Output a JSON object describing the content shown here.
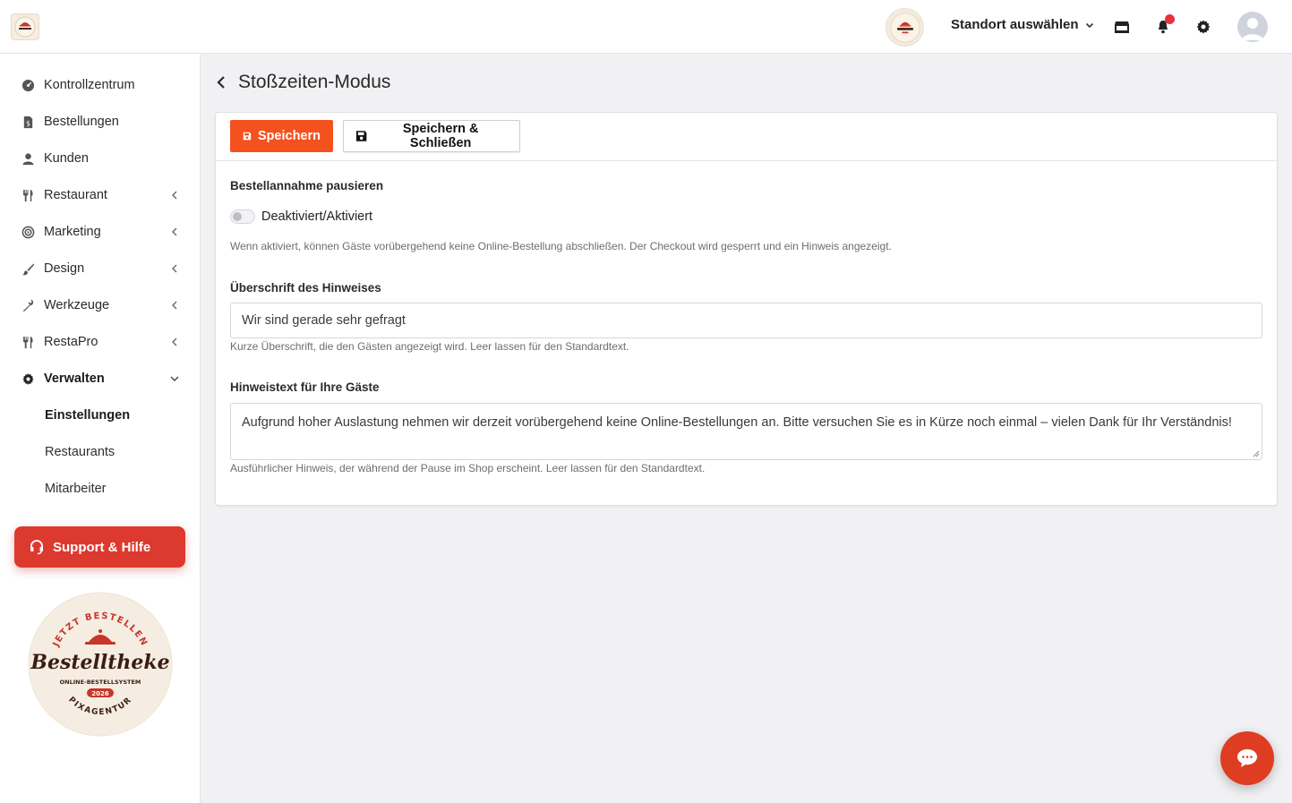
{
  "header": {
    "location_label": "Standort auswählen"
  },
  "sidebar": {
    "items": [
      {
        "label": "Kontrollzentrum"
      },
      {
        "label": "Bestellungen"
      },
      {
        "label": "Kunden"
      },
      {
        "label": "Restaurant"
      },
      {
        "label": "Marketing"
      },
      {
        "label": "Design"
      },
      {
        "label": "Werkzeuge"
      },
      {
        "label": "RestaPro"
      },
      {
        "label": "Verwalten"
      }
    ],
    "subitems": [
      {
        "label": "Einstellungen"
      },
      {
        "label": "Restaurants"
      },
      {
        "label": "Mitarbeiter"
      }
    ],
    "support_label": "Support & Hilfe"
  },
  "page": {
    "title": "Stoßzeiten-Modus",
    "save_label": "Speichern",
    "save_close_label": "Speichern & Schließen"
  },
  "form": {
    "pause_label": "Bestellannahme pausieren",
    "toggle_label": "Deaktiviert/Aktiviert",
    "toggle_on": false,
    "pause_help": "Wenn aktiviert, können Gäste vorübergehend keine Online-Bestellung abschließen. Der Checkout wird gesperrt und ein Hinweis angezeigt.",
    "headline_label": "Überschrift des Hinweises",
    "headline_value": "Wir sind gerade sehr gefragt",
    "headline_help": "Kurze Überschrift, die den Gästen angezeigt wird. Leer lassen für den Standardtext.",
    "notice_label": "Hinweistext für Ihre Gäste",
    "notice_value": "Aufgrund hoher Auslastung nehmen wir derzeit vorübergehend keine Online-Bestellungen an. Bitte versuchen Sie es in Kürze noch einmal – vielen Dank für Ihr Verständnis!",
    "notice_help": "Ausführlicher Hinweis, der während der Pause im Shop erscheint. Leer lassen für den Standardtext."
  },
  "brand": {
    "badge_top": "JETZT BESTELLEN",
    "badge_name": "Bestelltheke",
    "badge_sub": "ONLINE-BESTELLSYSTEM",
    "badge_year": "2026",
    "badge_bottom": "PIXAGENTUR",
    "accent": "#f4511e",
    "support_color": "#dc3a2e"
  }
}
